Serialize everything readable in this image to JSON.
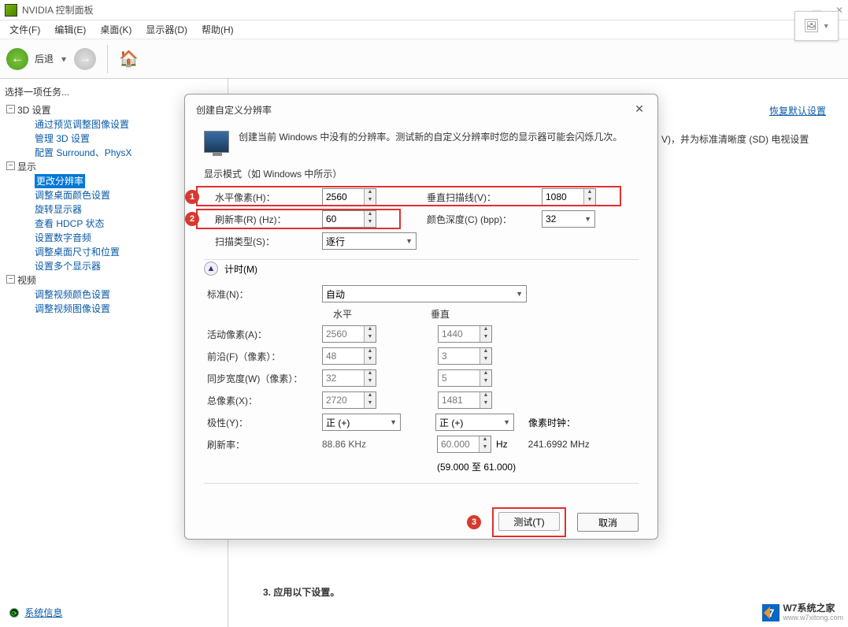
{
  "window": {
    "title": "NVIDIA 控制面板",
    "minimize": "—",
    "close": "✕"
  },
  "menubar": [
    "文件(F)",
    "编辑(E)",
    "桌面(K)",
    "显示器(D)",
    "帮助(H)"
  ],
  "toolbar": {
    "back_label": "后退"
  },
  "sidebar": {
    "title": "选择一项任务...",
    "nodes": [
      {
        "label": "3D 设置",
        "children": [
          "通过预览调整图像设置",
          "管理 3D 设置",
          "配置 Surround、PhysX"
        ]
      },
      {
        "label": "显示",
        "children": [
          "更改分辨率",
          "调整桌面颜色设置",
          "旋转显示器",
          "查看 HDCP 状态",
          "设置数字音频",
          "调整桌面尺寸和位置",
          "设置多个显示器"
        ]
      },
      {
        "label": "视频",
        "children": [
          "调整视频颜色设置",
          "调整视频图像设置"
        ]
      }
    ],
    "sysinfo": "系统信息"
  },
  "content": {
    "restore": "恢复默认设置",
    "bg_line": "V)，并为标准清晰度 (SD) 电视设置",
    "step3": "3. 应用以下设置。"
  },
  "dialog": {
    "title": "创建自定义分辨率",
    "intro": "创建当前 Windows 中没有的分辨率。测试新的自定义分辨率时您的显示器可能会闪烁几次。",
    "section_display": "显示模式（如 Windows 中所示）",
    "hpixels_lbl": "水平像素(H)：",
    "hpixels_val": "2560",
    "vscan_lbl": "垂直扫描线(V)：",
    "vscan_val": "1080",
    "refresh_lbl": "刷新率(R) (Hz)：",
    "refresh_val": "60",
    "depth_lbl": "颜色深度(C) (bpp)：",
    "depth_val": "32",
    "scan_lbl": "扫描类型(S)：",
    "scan_val": "逐行",
    "timing_lbl": "计时(M)",
    "standard_lbl": "标准(N)：",
    "standard_val": "自动",
    "col_h": "水平",
    "col_v": "垂直",
    "active_lbl": "活动像素(A)：",
    "active_h": "2560",
    "active_v": "1440",
    "front_lbl": "前沿(F)（像素）：",
    "front_h": "48",
    "front_v": "3",
    "sync_lbl": "同步宽度(W)（像素）：",
    "sync_h": "32",
    "sync_v": "5",
    "total_lbl": "总像素(X)：",
    "total_h": "2720",
    "total_v": "1481",
    "polarity_lbl": "极性(Y)：",
    "pol_h": "正 (+)",
    "pol_v": "正 (+)",
    "refresh2_lbl": "刷新率：",
    "refresh2_h": "88.86 KHz",
    "refresh2_v": "60.000",
    "refresh2_unit": "Hz",
    "pixclock_lbl": "像素时钟：",
    "pixclock_val": "241.6992 MHz",
    "range": "(59.000 至 61.000)",
    "test": "测试(T)",
    "cancel": "取消"
  },
  "badges": {
    "b1": "1",
    "b2": "2",
    "b3": "3"
  },
  "watermark": {
    "brand": "W7系统之家",
    "url": "www.w7xitong.com",
    "logo": "7"
  }
}
